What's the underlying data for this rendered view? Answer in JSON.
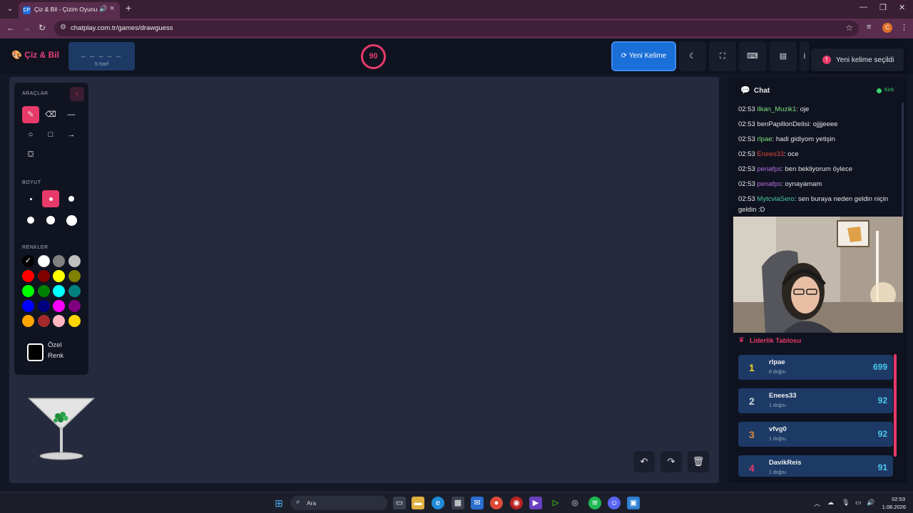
{
  "browser": {
    "tab_title": "Çiz & Bil - Çizim Oyunu",
    "tab_favicon": "CP",
    "url": "chatplay.com.tr/games/drawguess",
    "profile_initial": "C"
  },
  "header": {
    "logo": "Çiz & Bil",
    "word_dashes": "_ _ _ _ _",
    "word_count": "5 harf",
    "timer": "90",
    "new_word_button": "Yeni Kelime",
    "toast": "Yeni kelime seçildi"
  },
  "tools_panel": {
    "tools_label": "ARAÇLAR",
    "size_label": "BOYUT",
    "colors_label": "RENKLER",
    "custom_color_line1": "Özel",
    "custom_color_line2": "Renk",
    "colors": [
      "#000000",
      "#ffffff",
      "#808080",
      "#c0c0c0",
      "#ff0000",
      "#800000",
      "#ffff00",
      "#808000",
      "#00ff00",
      "#008000",
      "#00ffff",
      "#008080",
      "#0000ff",
      "#000080",
      "#ff00ff",
      "#800080",
      "#ffa500",
      "#a52a2a",
      "#ffb6c1",
      "#ffd700"
    ]
  },
  "chat": {
    "title": "Chat",
    "platform": "Kick",
    "messages": [
      {
        "time": "02:53",
        "user": "ilkan_Muzik1",
        "color": "#7ee07e",
        "text": ": oje"
      },
      {
        "time": "02:53",
        "user": "benPapillonDelisi",
        "color": "#e6e6e6",
        "text": ": ojjjjeeee"
      },
      {
        "time": "02:53",
        "user": "rlpae",
        "color": "#7ee07e",
        "text": ": hadi gidiyom yetişin"
      },
      {
        "time": "02:53",
        "user": "Enees33",
        "color": "#e0453a",
        "text": ": oce"
      },
      {
        "time": "02:53",
        "user": "penafps",
        "color": "#b36ee0",
        "text": ": ben bekliyorum öylece"
      },
      {
        "time": "02:53",
        "user": "penafps",
        "color": "#b36ee0",
        "text": ": oynayamam"
      },
      {
        "time": "02:53",
        "user": "MytcviaSero",
        "color": "#4cc9a0",
        "text": ": sen buraya neden geldin niçin geldin :D"
      }
    ]
  },
  "leaderboard": {
    "title": "Liderlik Tablosu",
    "rows": [
      {
        "rank": "1",
        "name": "rlpae",
        "sub": "8 doğru",
        "score": "699",
        "rank_color": "#f5d020"
      },
      {
        "rank": "2",
        "name": "Enees33",
        "sub": "1 doğru",
        "score": "92",
        "rank_color": "#cfd4dc"
      },
      {
        "rank": "3",
        "name": "vfvg0",
        "sub": "1 doğru",
        "score": "92",
        "rank_color": "#e08a3a"
      },
      {
        "rank": "4",
        "name": "DavikReis",
        "sub": "1 doğru",
        "score": "91",
        "rank_color": "#e83a6a"
      }
    ]
  },
  "taskbar": {
    "search_placeholder": "Ara",
    "time": "02:53",
    "date": "1.08.2026"
  },
  "colors": {
    "accent": "#e83a6a",
    "primary_button": "#1a6fd8",
    "panel": "#101421",
    "canvas": "#262a3e"
  }
}
